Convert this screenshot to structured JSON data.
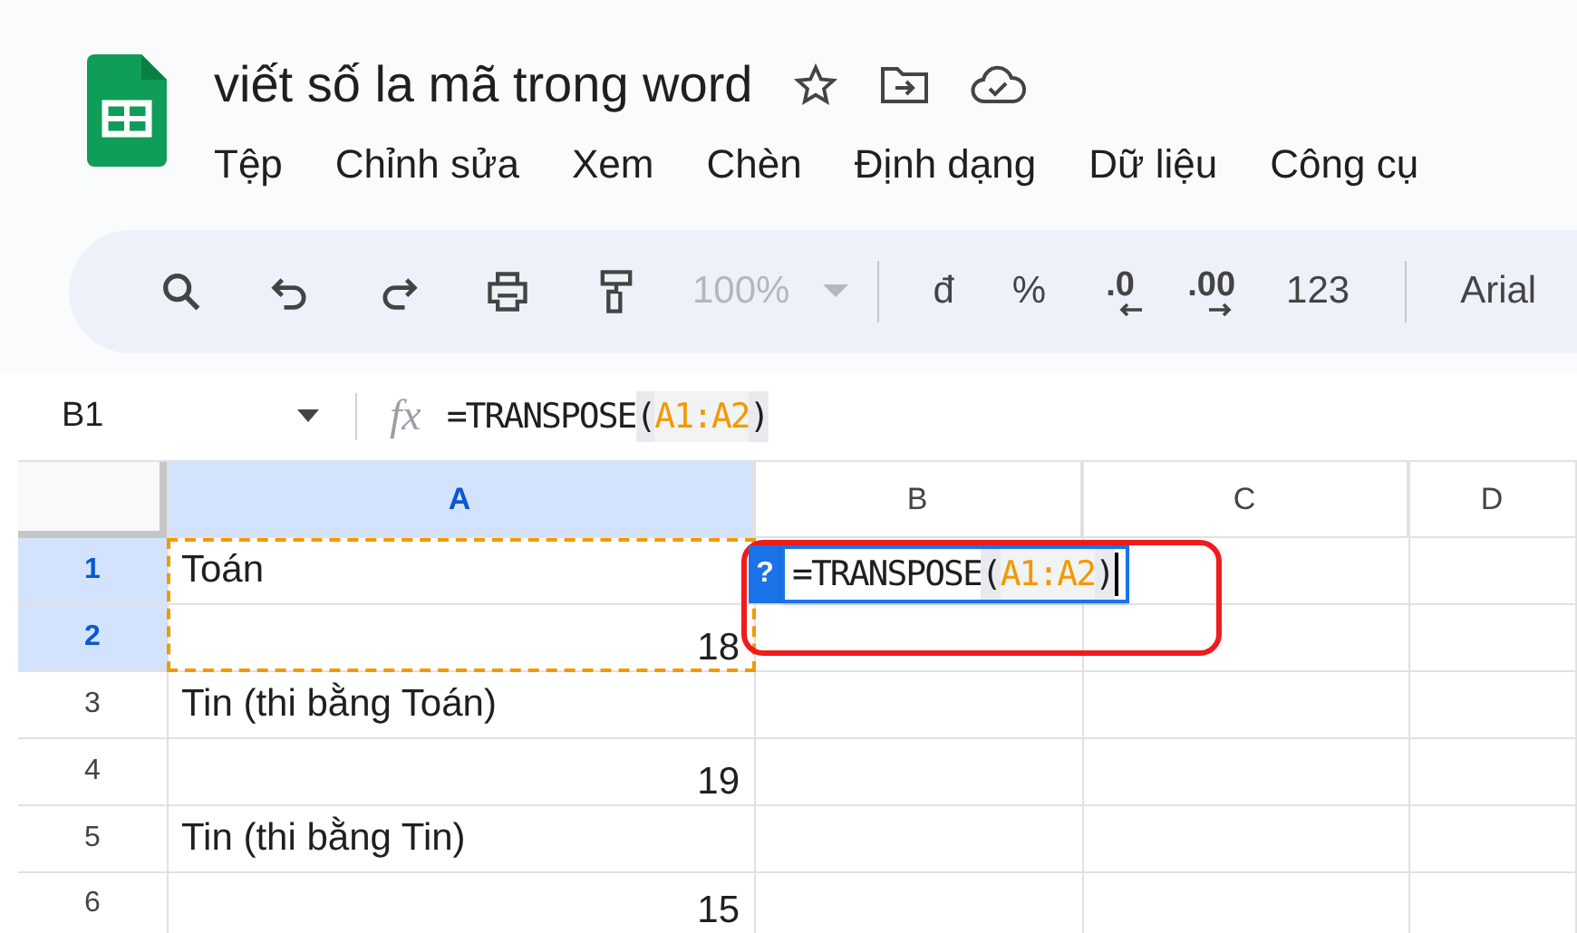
{
  "document": {
    "title": "viết số la mã trong word"
  },
  "menu": [
    "Tệp",
    "Chỉnh sửa",
    "Xem",
    "Chèn",
    "Định dạng",
    "Dữ liệu",
    "Công cụ"
  ],
  "toolbar": [
    {
      "kind": "search"
    },
    {
      "kind": "undo"
    },
    {
      "kind": "redo"
    },
    {
      "kind": "print"
    },
    {
      "kind": "paint"
    },
    {
      "kind": "zoom",
      "text": "100%",
      "disabled": true
    },
    {
      "kind": "sep"
    },
    {
      "kind": "text",
      "text": "đ"
    },
    {
      "kind": "text",
      "text": "%"
    },
    {
      "kind": "dec_less",
      "text": ".0"
    },
    {
      "kind": "dec_more",
      "text": ".00"
    },
    {
      "kind": "text",
      "text": "123"
    },
    {
      "kind": "sep"
    },
    {
      "kind": "text",
      "text": "Arial"
    }
  ],
  "formula_bar": {
    "cell_ref": "B1",
    "function_label": "fx",
    "tokens": [
      {
        "kind": "plain",
        "text": "=TRANSPOSE"
      },
      {
        "kind": "paren",
        "text": "("
      },
      {
        "kind": "range",
        "text": "A1:A2"
      },
      {
        "kind": "paren",
        "text": ")"
      }
    ]
  },
  "columns": [
    {
      "label": "A",
      "selected": true
    },
    {
      "label": "B",
      "selected": false
    },
    {
      "label": "C",
      "selected": false
    },
    {
      "label": "D",
      "selected": false
    }
  ],
  "rows": [
    {
      "label": "1",
      "selected": true,
      "cells": [
        {
          "kind": "text",
          "text": "Toán",
          "in_copy_range": true
        }
      ]
    },
    {
      "label": "2",
      "selected": true,
      "cells": [
        {
          "kind": "number",
          "text": "18",
          "in_copy_range": true
        }
      ]
    },
    {
      "label": "3",
      "selected": false,
      "cells": [
        {
          "kind": "text",
          "text": "Tin (thi bằng Toán)",
          "in_copy_range": false
        }
      ]
    },
    {
      "label": "4",
      "selected": false,
      "cells": [
        {
          "kind": "number",
          "text": "19",
          "in_copy_range": false
        }
      ]
    },
    {
      "label": "5",
      "selected": false,
      "cells": [
        {
          "kind": "text",
          "text": "Tin (thi bằng Tin)",
          "in_copy_range": false
        }
      ]
    },
    {
      "label": "6",
      "selected": false,
      "cells": [
        {
          "kind": "number",
          "text": "15",
          "in_copy_range": false
        }
      ]
    }
  ],
  "editor": {
    "badge": "?",
    "tokens": [
      {
        "kind": "plain",
        "text": "=TRANSPOSE"
      },
      {
        "kind": "paren",
        "text": "("
      },
      {
        "kind": "range",
        "text": "A1:A2"
      },
      {
        "kind": "paren",
        "text": ")"
      }
    ]
  }
}
